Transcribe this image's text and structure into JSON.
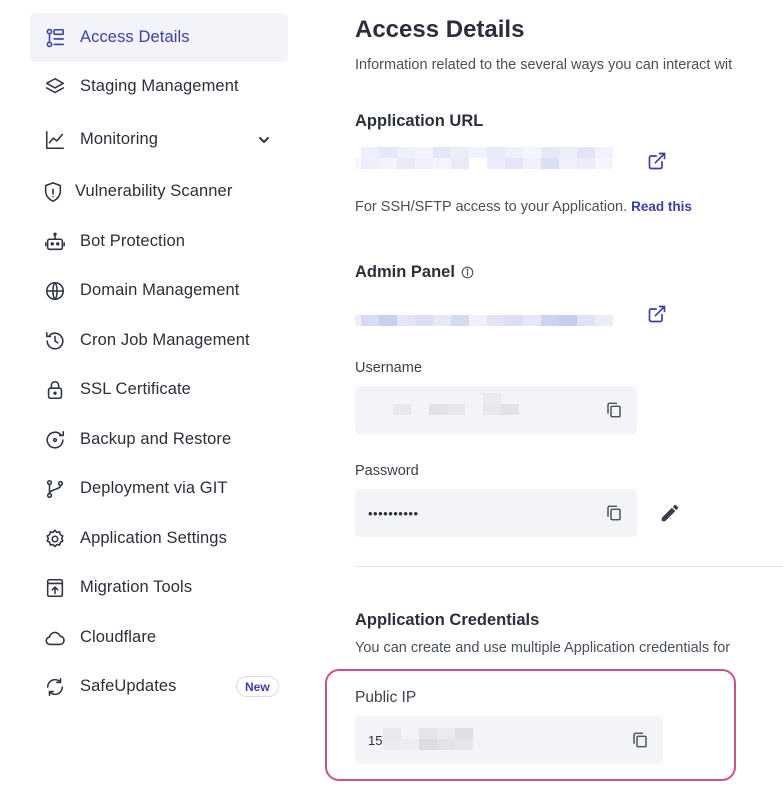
{
  "sidebar": {
    "items": [
      {
        "label": "Access Details",
        "icon": "access-details-icon",
        "active": true
      },
      {
        "label": "Staging Management",
        "icon": "layers-icon"
      },
      {
        "label": "Monitoring",
        "icon": "chart-line-icon",
        "expandable": true
      },
      {
        "label": "Vulnerability Scanner",
        "icon": "shield-warning-icon"
      },
      {
        "label": "Bot Protection",
        "icon": "robot-icon"
      },
      {
        "label": "Domain Management",
        "icon": "www-globe-icon"
      },
      {
        "label": "Cron Job Management",
        "icon": "history-clock-icon"
      },
      {
        "label": "SSL Certificate",
        "icon": "lock-icon"
      },
      {
        "label": "Backup and Restore",
        "icon": "backup-restore-icon"
      },
      {
        "label": "Deployment via GIT",
        "icon": "git-branch-icon"
      },
      {
        "label": "Application Settings",
        "icon": "gear-icon"
      },
      {
        "label": "Migration Tools",
        "icon": "migration-icon"
      },
      {
        "label": "Cloudflare",
        "icon": "cloud-icon"
      },
      {
        "label": "SafeUpdates",
        "icon": "refresh-icon",
        "badge": "New"
      }
    ]
  },
  "main": {
    "title": "Access Details",
    "description": "Information related to the several ways you can interact wit",
    "application_url": {
      "title": "Application URL",
      "note": "For SSH/SFTP access to your Application.",
      "link": "Read this"
    },
    "admin_panel": {
      "title": "Admin Panel",
      "username_label": "Username",
      "password_label": "Password",
      "password_value": "••••••••••"
    },
    "credentials": {
      "title": "Application Credentials",
      "description": "You can create and use multiple Application credentials for"
    },
    "public_ip": {
      "label": "Public IP",
      "value_prefix": "15"
    }
  },
  "colors": {
    "accent": "#3b3fa8",
    "active_bg": "#f3f4f9",
    "field_bg": "#f3f4f7",
    "highlight": "#c7538b"
  }
}
